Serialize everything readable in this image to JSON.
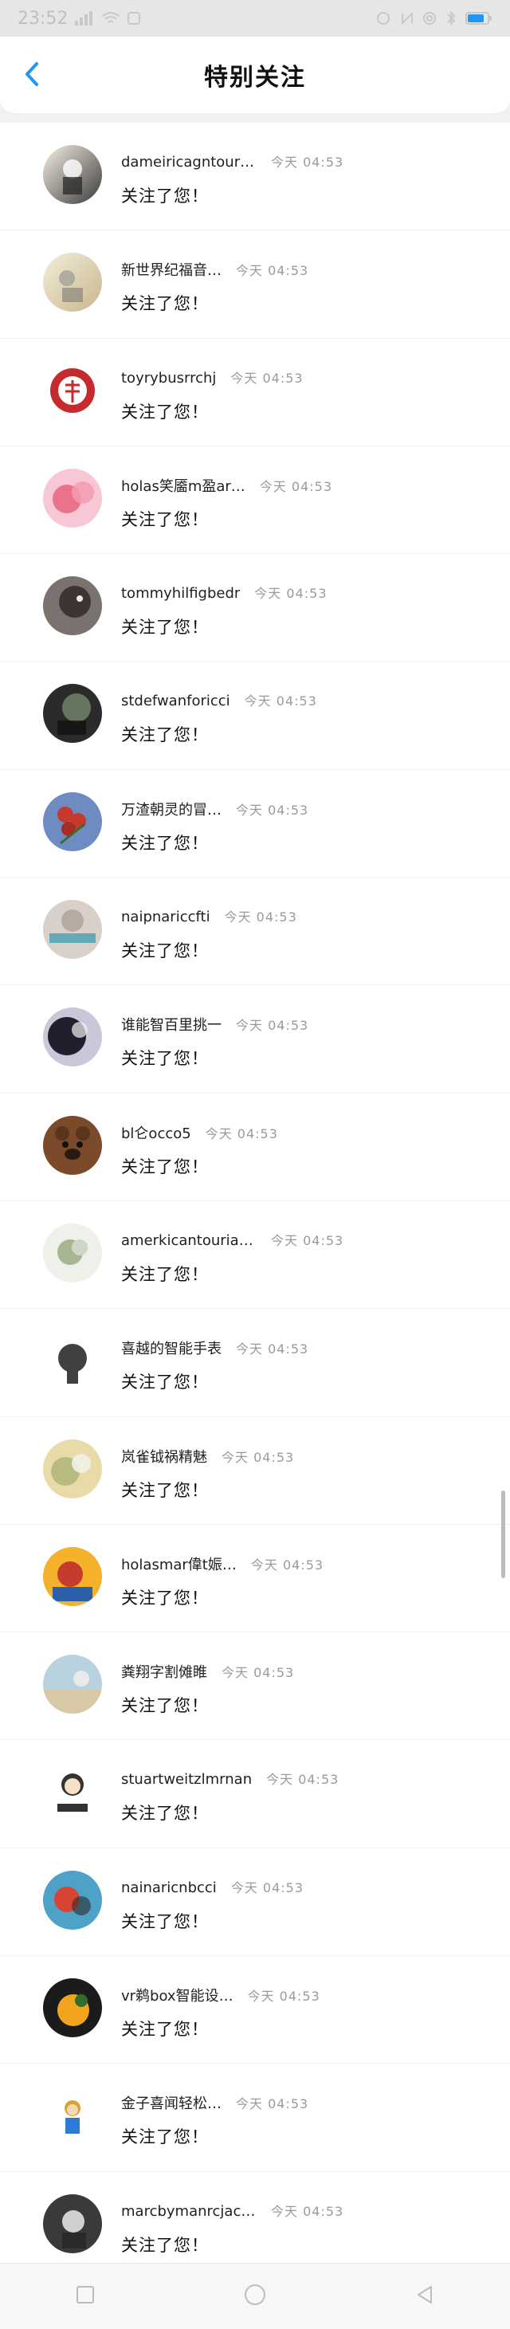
{
  "status_bar": {
    "time": "23:52",
    "signal_icon": "signal-icon",
    "wifi_icon": "wifi-icon",
    "battery_icon": "battery-icon"
  },
  "header": {
    "title": "特别关注",
    "back_icon": "back-chevron-icon"
  },
  "items": [
    {
      "name": "dameiricagntouri…",
      "time": "今天 04:53",
      "message": "关注了您！",
      "avatar_colors": [
        "#f7f0e6",
        "#3a3a3a"
      ]
    },
    {
      "name": "新世界纪福音…",
      "time": "今天 04:53",
      "message": "关注了您！",
      "avatar_colors": [
        "#f3edd7",
        "#c9b78f"
      ]
    },
    {
      "name": "toyrybusrrchj",
      "time": "今天 04:53",
      "message": "关注了您！",
      "avatar_colors": [
        "#ffffff",
        "#c52a2f"
      ]
    },
    {
      "name": "holas笑靥m盈ar…",
      "time": "今天 04:53",
      "message": "关注了您！",
      "avatar_colors": [
        "#f7c7d6",
        "#e8637d"
      ]
    },
    {
      "name": "tommyhilfigbedr",
      "time": "今天 04:53",
      "message": "关注了您！",
      "avatar_colors": [
        "#7a726e",
        "#3d3434"
      ]
    },
    {
      "name": "stdefwanforicci",
      "time": "今天 04:53",
      "message": "关注了您！",
      "avatar_colors": [
        "#2b2b2b",
        "#6d7d66"
      ]
    },
    {
      "name": "万渣朝灵的冒…",
      "time": "今天 04:53",
      "message": "关注了您！",
      "avatar_colors": [
        "#c53a2c",
        "#6e8cc2"
      ]
    },
    {
      "name": "naipnariccfti",
      "time": "今天 04:53",
      "message": "关注了您！",
      "avatar_colors": [
        "#d9d0c9",
        "#65a9b9"
      ]
    },
    {
      "name": "谁能智百里挑一",
      "time": "今天 04:53",
      "message": "关注了您！",
      "avatar_colors": [
        "#c8c8d8",
        "#1f1f2e"
      ]
    },
    {
      "name": "bl仑occo5",
      "time": "今天 04:53",
      "message": "关注了您！",
      "avatar_colors": [
        "#7b4a2b",
        "#2b1a10"
      ]
    },
    {
      "name": "amerkicantourias…",
      "time": "今天 04:53",
      "message": "关注了您！",
      "avatar_colors": [
        "#eef0ea",
        "#a7b593"
      ]
    },
    {
      "name": "喜越的智能手表",
      "time": "今天 04:53",
      "message": "关注了您！",
      "avatar_colors": [
        "#ffffff",
        "#404040"
      ]
    },
    {
      "name": "岚雀钺祸精魅",
      "time": "今天 04:53",
      "message": "关注了您！",
      "avatar_colors": [
        "#e8dba8",
        "#b2b77a"
      ]
    },
    {
      "name": "holasmar偉t娠…",
      "time": "今天 04:53",
      "message": "关注了您！",
      "avatar_colors": [
        "#f3b12c",
        "#c53b2e"
      ]
    },
    {
      "name": "粪翔字割傩睢",
      "time": "今天 04:53",
      "message": "关注了您！",
      "avatar_colors": [
        "#b8d2df",
        "#d8c9a6"
      ]
    },
    {
      "name": "stuartweitzlmrnan",
      "time": "今天 04:53",
      "message": "关注了您！",
      "avatar_colors": [
        "#ffffff",
        "#333333"
      ]
    },
    {
      "name": "nainaricnbcci",
      "time": "今天 04:53",
      "message": "关注了您！",
      "avatar_colors": [
        "#4ea1c7",
        "#d64533"
      ]
    },
    {
      "name": "vr鹈box智能设…",
      "time": "今天 04:53",
      "message": "关注了您！",
      "avatar_colors": [
        "#1b1b1b",
        "#f2a41c"
      ]
    },
    {
      "name": "金子喜闻轻松…",
      "time": "今天 04:53",
      "message": "关注了您！",
      "avatar_colors": [
        "#ffffff",
        "#d9a42b"
      ]
    },
    {
      "name": "marcbymanrcjaco…",
      "time": "今天 04:53",
      "message": "关注了您！",
      "avatar_colors": [
        "#3a3a3a",
        "#d0d0d0"
      ]
    }
  ],
  "navbar": {
    "recent_icon": "square-icon",
    "home_icon": "circle-icon",
    "back_icon": "triangle-back-icon"
  },
  "colors": {
    "accent": "#2196f3",
    "background": "#f2f2f2",
    "card": "#ffffff"
  }
}
